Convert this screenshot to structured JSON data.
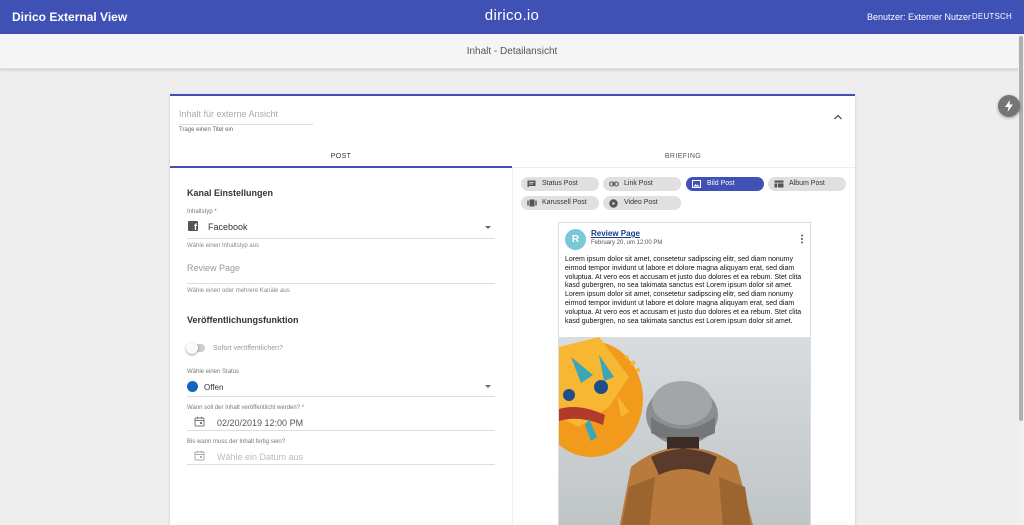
{
  "topbar": {
    "app_title": "Dirico External View",
    "logo": "dirico.io",
    "user": "Benutzer: Externer Nutzer",
    "language": "DEUTSCH"
  },
  "subheader": {
    "title": "Inhalt - Detailansicht"
  },
  "content": {
    "title_placeholder": "Inhalt für externe Ansicht",
    "title_hint": "Trage einen Titel ein"
  },
  "tabs": [
    {
      "label": "POST"
    },
    {
      "label": "BRIEFING"
    }
  ],
  "form": {
    "channel_section": "Kanal Einstellungen",
    "content_type": {
      "label": "Inhaltstyp *",
      "value": "Facebook",
      "hint": "Wähle einen Inhaltstyp aus",
      "icon": "facebook-icon"
    },
    "channels": {
      "placeholder": "Review Page",
      "hint": "Wähle einen oder mehrere Kanäle aus"
    },
    "publish_section": "Veröffentlichungsfunktion",
    "instant_publish": {
      "label": "Sofort veröffentlichen?",
      "checked": false
    },
    "status": {
      "label": "Wähle einen Status",
      "value": "Offen",
      "color": "#1565c0"
    },
    "publish_date": {
      "label": "Wann soll der Inhalt veröffentlicht werden? *",
      "value": "02/20/2019 12:00 PM"
    },
    "due_date": {
      "label": "Bis wann muss der Inhalt fertig sein?",
      "placeholder": "Wähle ein Datum aus"
    }
  },
  "post_types": [
    {
      "label": "Status Post",
      "icon": "comment-icon",
      "active": false
    },
    {
      "label": "Link Post",
      "icon": "link-icon",
      "active": false
    },
    {
      "label": "Bild Post",
      "icon": "image-icon",
      "active": true
    },
    {
      "label": "Album Post",
      "icon": "album-icon",
      "active": false
    },
    {
      "label": "Karussell Post",
      "icon": "carousel-icon",
      "active": false
    },
    {
      "label": "Video Post",
      "icon": "play-icon",
      "active": false
    }
  ],
  "preview": {
    "avatar_letter": "R",
    "page_name": "Review Page",
    "date": "February 20, um 12:00 PM",
    "text": "Lorem ipsum dolor sit amet, consetetur sadipscing elitr, sed diam nonumy eirmod tempor invidunt ut labore et dolore magna aliquyam erat, sed diam voluptua. At vero eos et accusam et justo duo dolores et ea rebum. Stet clita kasd gubergren, no sea takimata sanctus est Lorem ipsum dolor sit amet. Lorem ipsum dolor sit amet, consetetur sadipscing elitr, sed diam nonumy eirmod tempor invidunt ut labore et dolore magna aliquyam erat, sed diam voluptua. At vero eos et accusam et justo duo dolores et ea rebum. Stet clita kasd gubergren, no sea takimata sanctus est Lorem ipsum dolor sit amet."
  },
  "colors": {
    "primary": "#3f51b5",
    "status_open": "#1565c0",
    "avatar": "#78c8d8"
  }
}
